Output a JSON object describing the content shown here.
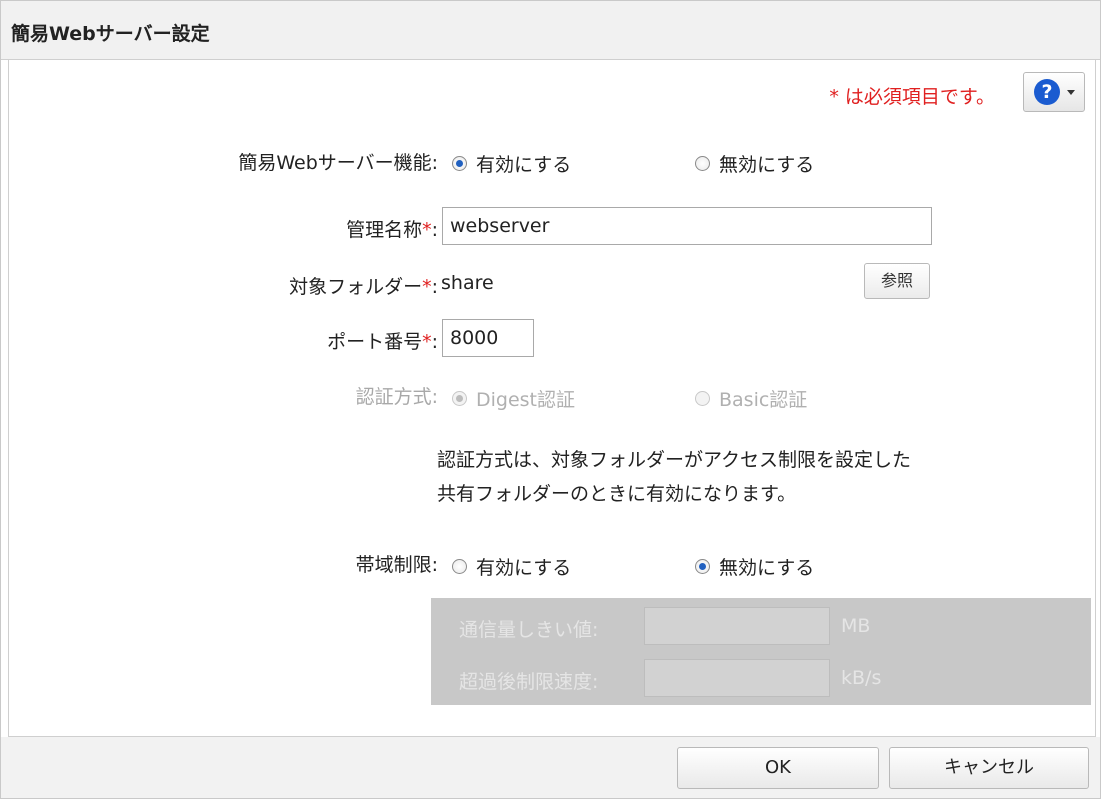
{
  "dialog": {
    "title": "簡易Webサーバー設定",
    "required_note": "* は必須項目です。",
    "help_icon_text": "?"
  },
  "web_server": {
    "label": "簡易Webサーバー機能:",
    "enable_label": "有効にする",
    "disable_label": "無効にする",
    "selected": "enable"
  },
  "admin_name": {
    "label": "管理名称",
    "asterisk": "*",
    "colon": ":",
    "value": "webserver"
  },
  "target_folder": {
    "label": "対象フォルダー",
    "asterisk": "*",
    "colon": ":",
    "value": "share",
    "browse_label": "参照"
  },
  "port": {
    "label": "ポート番号",
    "asterisk": "*",
    "colon": ":",
    "value": "8000"
  },
  "auth": {
    "label": "認証方式:",
    "digest_label": "Digest認証",
    "basic_label": "Basic認証",
    "selected": "digest",
    "disabled": true
  },
  "auth_note": {
    "line1": "認証方式は、対象フォルダーがアクセス制限を設定した",
    "line2": "共有フォルダーのときに有効になります。"
  },
  "bandwidth": {
    "label": "帯域制限:",
    "enable_label": "有効にする",
    "disable_label": "無効にする",
    "selected": "disable",
    "threshold_label": "通信量しきい値:",
    "threshold_unit": "MB",
    "limit_label": "超過後制限速度:",
    "limit_unit": "kB/s"
  },
  "footer": {
    "ok_label": "OK",
    "cancel_label": "キャンセル"
  }
}
